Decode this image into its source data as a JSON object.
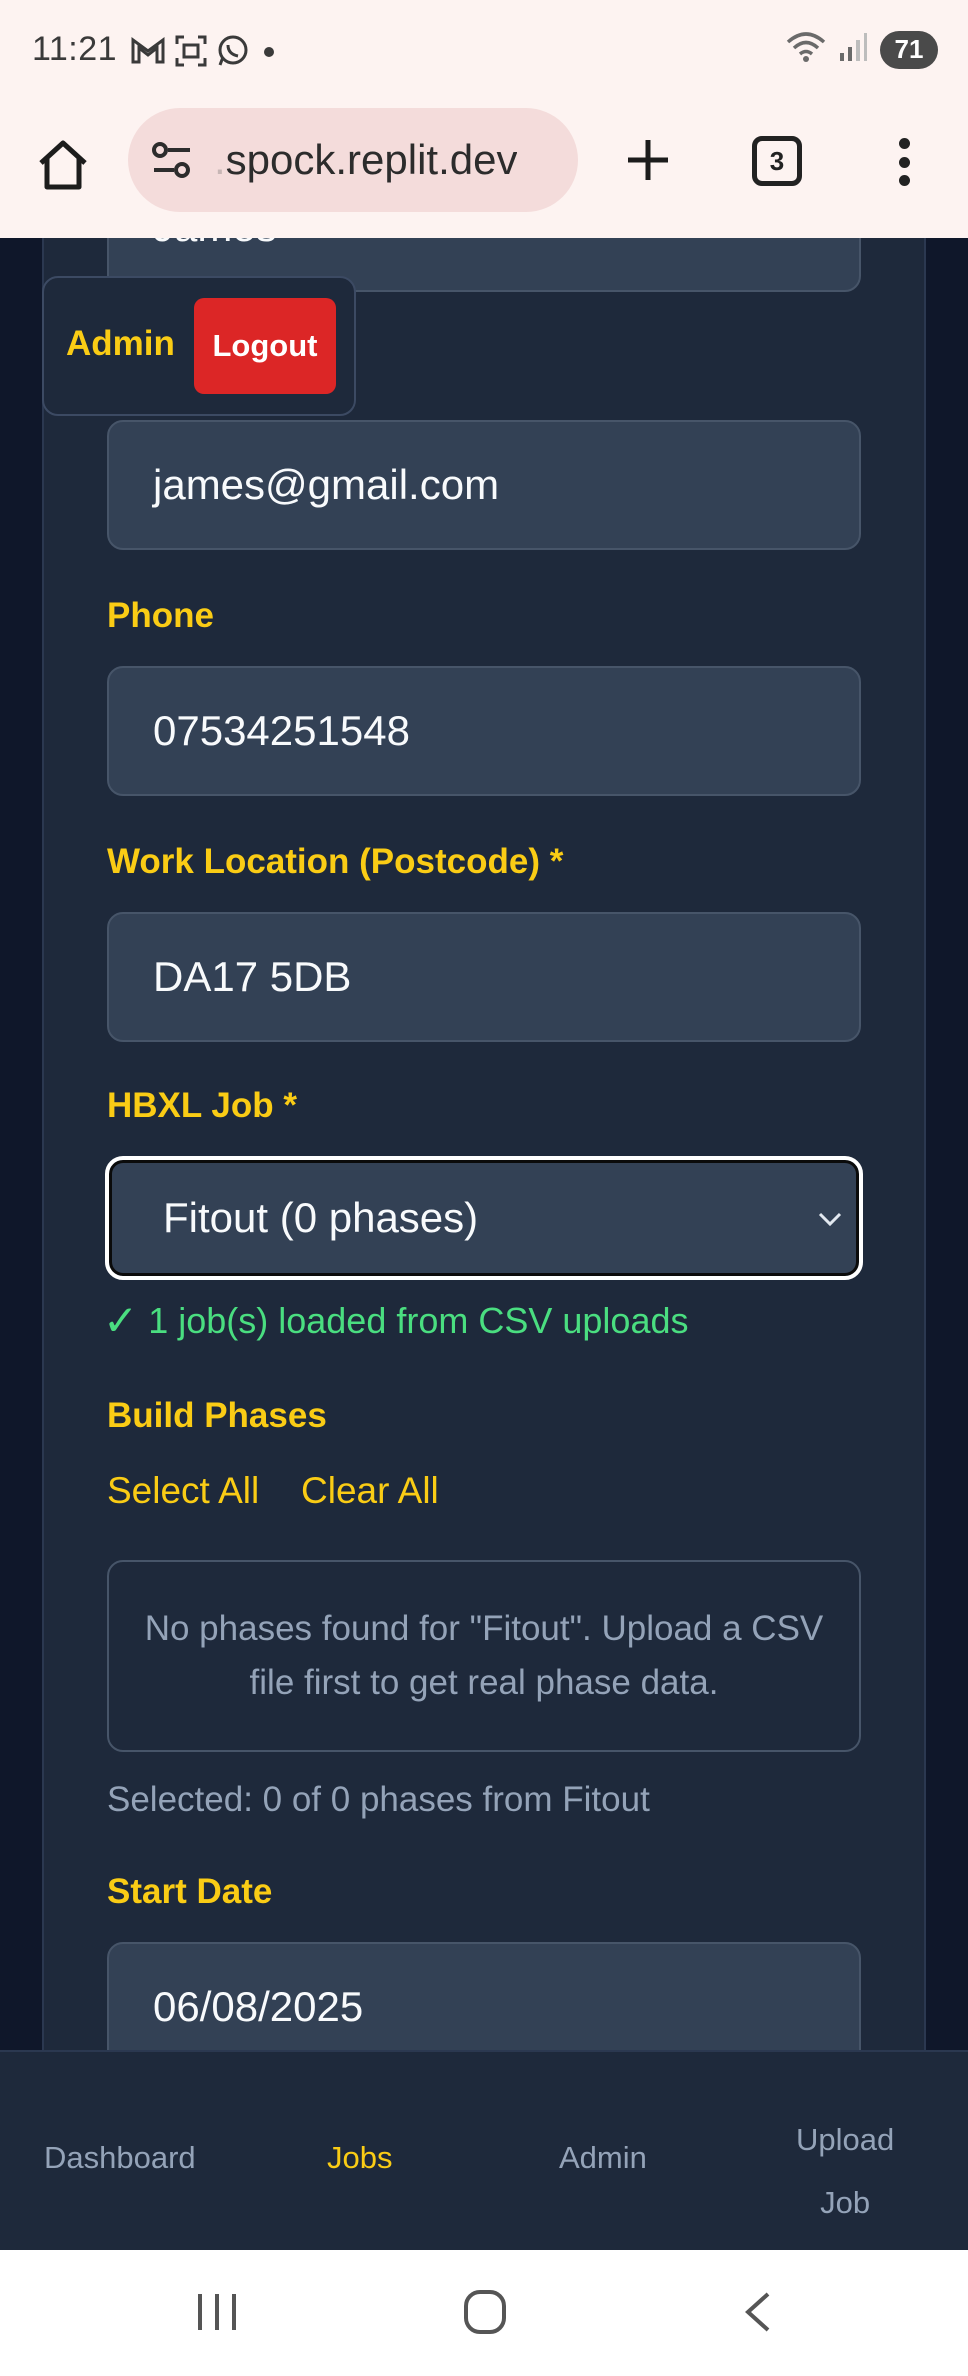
{
  "status_bar": {
    "time": "11:21",
    "battery": "71",
    "icons": [
      "gmail-icon",
      "screenshot-icon",
      "whatsapp-icon",
      "dot-icon",
      "wifi-icon",
      "signal-icon"
    ]
  },
  "browser": {
    "url_faded": ".",
    "url": "spock.replit.dev",
    "tab_count": "3"
  },
  "form": {
    "name_value": "James",
    "email_value": "james@gmail.com",
    "phone_label": "Phone",
    "phone_value": "07534251548",
    "location_label": "Work Location (Postcode) *",
    "location_value": "DA17 5DB",
    "job_label": "HBXL Job *",
    "job_selected": "Fitout (0 phases)",
    "loaded_check": "✓",
    "loaded_text": "1 job(s) loaded from CSV uploads",
    "phases_label": "Build Phases",
    "select_all": "Select All",
    "clear_all": "Clear All",
    "no_phases_message": "No phases found for \"Fitout\". Upload a CSV file first to get real phase data.",
    "selected_text": "Selected: 0 of 0 phases from Fitout",
    "start_date_label": "Start Date",
    "start_date_value": "06/08/2025"
  },
  "admin_panel": {
    "label": "Admin",
    "logout": "Logout"
  },
  "bottom_nav": {
    "dashboard": "Dashboard",
    "jobs": "Jobs",
    "admin": "Admin",
    "upload_line1": "Upload",
    "upload_line2": "Job",
    "active": "Jobs"
  },
  "colors": {
    "accent": "#facc15",
    "danger": "#dc2626",
    "success": "#4ade80",
    "card_bg": "#1e293b",
    "input_bg": "#334155",
    "page_bg": "#0f172a"
  }
}
